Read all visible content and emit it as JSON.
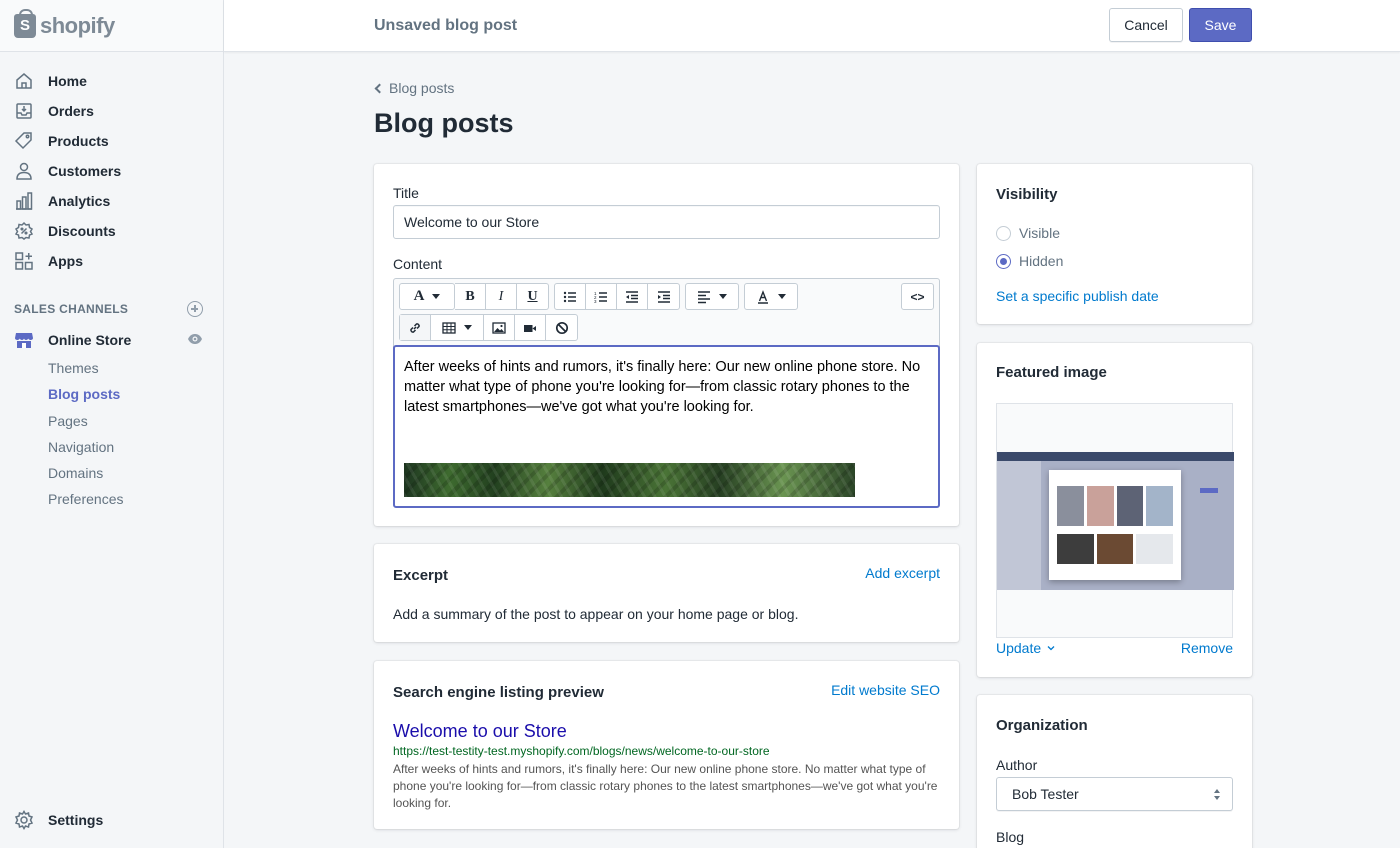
{
  "app": {
    "logo_text": "shopify",
    "logo_glyph": "S"
  },
  "sidebar": {
    "items": [
      {
        "label": "Home",
        "icon": "home-icon"
      },
      {
        "label": "Orders",
        "icon": "orders-icon"
      },
      {
        "label": "Products",
        "icon": "tag-icon"
      },
      {
        "label": "Customers",
        "icon": "person-icon"
      },
      {
        "label": "Analytics",
        "icon": "bar-chart-icon"
      },
      {
        "label": "Discounts",
        "icon": "discount-icon"
      },
      {
        "label": "Apps",
        "icon": "apps-icon"
      }
    ],
    "sales_channels_title": "SALES CHANNELS",
    "online_store": "Online Store",
    "sub_items": [
      "Themes",
      "Blog posts",
      "Pages",
      "Navigation",
      "Domains",
      "Preferences"
    ],
    "active_sub_item": "Blog posts",
    "settings": "Settings"
  },
  "topbar": {
    "title": "Unsaved blog post",
    "cancel_label": "Cancel",
    "save_label": "Save"
  },
  "page": {
    "breadcrumb": "Blog posts",
    "title": "Blog posts"
  },
  "post": {
    "title_label": "Title",
    "title_value": "Welcome to our Store",
    "content_label": "Content",
    "content_text": "After weeks of hints and rumors, it's finally here: Our new online phone store. No matter what type of phone you're looking for—from classic rotary phones to the latest smartphones—we've got what you're looking for.",
    "toolbar": {
      "font_button": "A",
      "bold": "B",
      "italic": "I",
      "underline": "U",
      "html_button": "<>"
    }
  },
  "excerpt": {
    "heading": "Excerpt",
    "add_link": "Add excerpt",
    "description": "Add a summary of the post to appear on your home page or blog."
  },
  "seo": {
    "heading": "Search engine listing preview",
    "edit_link": "Edit website SEO",
    "preview_title": "Welcome to our Store",
    "preview_url": "https://test-testity-test.myshopify.com/blogs/news/welcome-to-our-store",
    "preview_description": "After weeks of hints and rumors, it's finally here: Our new online phone store. No matter what type of phone you're looking for—from classic rotary phones to the latest smartphones—we've got what you're looking for."
  },
  "visibility": {
    "heading": "Visibility",
    "options": [
      "Visible",
      "Hidden"
    ],
    "selected": "Hidden",
    "publish_link": "Set a specific publish date"
  },
  "featured_image": {
    "heading": "Featured image",
    "update_label": "Update",
    "remove_label": "Remove"
  },
  "organization": {
    "heading": "Organization",
    "author_label": "Author",
    "author_value": "Bob Tester",
    "blog_label": "Blog"
  },
  "colors": {
    "accent": "#5c6ac4",
    "link": "#007ace",
    "seo_title": "#1a0dab",
    "seo_url": "#006621"
  }
}
